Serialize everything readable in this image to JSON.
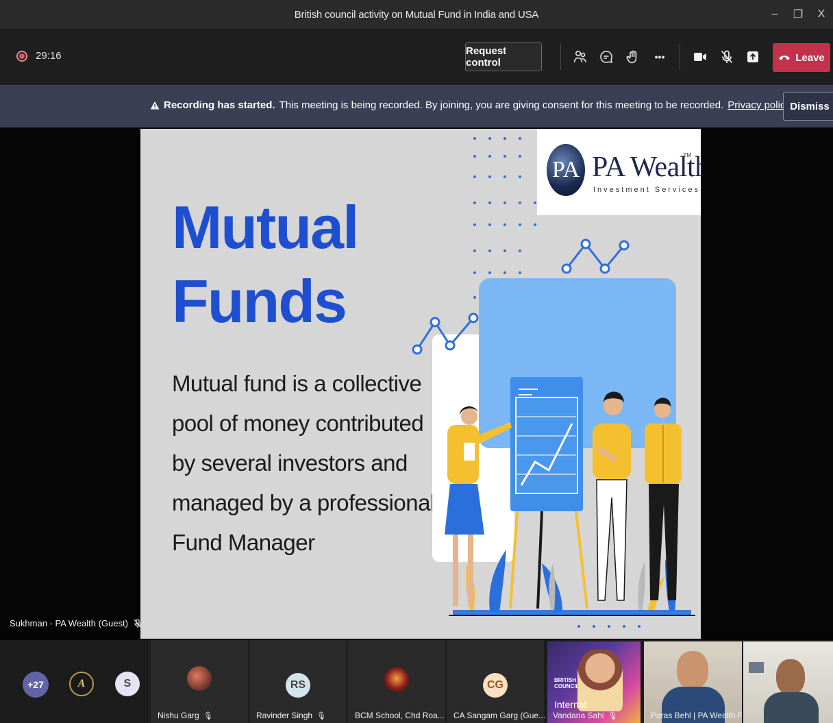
{
  "window": {
    "title": "British council activity on Mutual Fund in India and USA",
    "controls": [
      "–",
      "❐",
      "X"
    ]
  },
  "toolbar": {
    "timer": "29:16",
    "request_control_label": "Request control",
    "more_label": "•••",
    "leave_label": "Leave",
    "colors": {
      "leave": "#c4314b"
    }
  },
  "banner": {
    "icon": "warning-icon",
    "bold_text": "Recording has started.",
    "text": "This meeting is being recorded. By joining, you are giving consent for this meeting to be recorded.",
    "link_text": "Privacy policy",
    "dismiss_label": "Dismiss"
  },
  "slide": {
    "title_line1": "Mutual",
    "title_line2": "Funds",
    "body": "Mutual fund is a collective pool of money contributed by several investors and managed by a professional Fund Manager",
    "logo": {
      "monogram": "PA",
      "name": "PA Wealth",
      "tm": "TM",
      "subtitle": "Investment Services"
    },
    "colors": {
      "title": "#1f4fd1",
      "background": "#d6d6d6"
    }
  },
  "presenter": {
    "name": "Sukhman - PA Wealth (Guest)"
  },
  "participants": {
    "overflow_count": "+27",
    "avatar_a": "A",
    "avatar_s": "S",
    "tiles": [
      {
        "name": "Nishu Garg",
        "initials": ""
      },
      {
        "name": "Ravinder Singh",
        "initials": "RS"
      },
      {
        "name": "BCM School, Chd Roa...",
        "initials": ""
      },
      {
        "name": "CA Sangam Garg (Gue...",
        "initials": "CG"
      }
    ],
    "videos": [
      {
        "name": "Vandana Sahi",
        "badge": "BRITISH COUNCIL",
        "overlay": "Internat"
      },
      {
        "name": "Paras Behl | PA Wealth Pvt..."
      },
      {
        "name": ""
      }
    ]
  }
}
